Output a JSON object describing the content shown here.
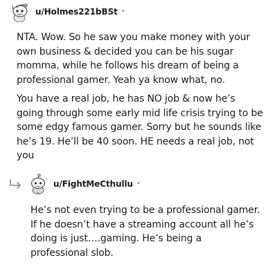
{
  "comments": [
    {
      "username": "u/Holmes221bBSt",
      "avatar": "snoo-avatar-icon",
      "paragraphs": [
        "NTA. Wow. So he saw you make money with your own business & decided you can be his sugar momma, while he follows his dream of being a professional gamer. Yeah ya know what, no.",
        "You have a real job, he has NO job & now he’s going through some early mid life crisis trying to be some edgy famous gamer. Sorry but he sounds like he’s 19. He’ll be 40 soon. HE needs a real job, not you"
      ]
    },
    {
      "username": "u/FightMeCthullu",
      "avatar": "snoo-avatar-icon",
      "reply_icon": "reply-arrow-icon",
      "paragraphs": [
        "He’s not even trying to be a professional gamer. If he doesn’t have a streaming account all he’s doing is just….gaming. He’s being a professional slob."
      ]
    }
  ],
  "colors": {
    "text": "#1a1a1b",
    "meta": "#878a8c",
    "reply_arrow": "#878a8c"
  }
}
